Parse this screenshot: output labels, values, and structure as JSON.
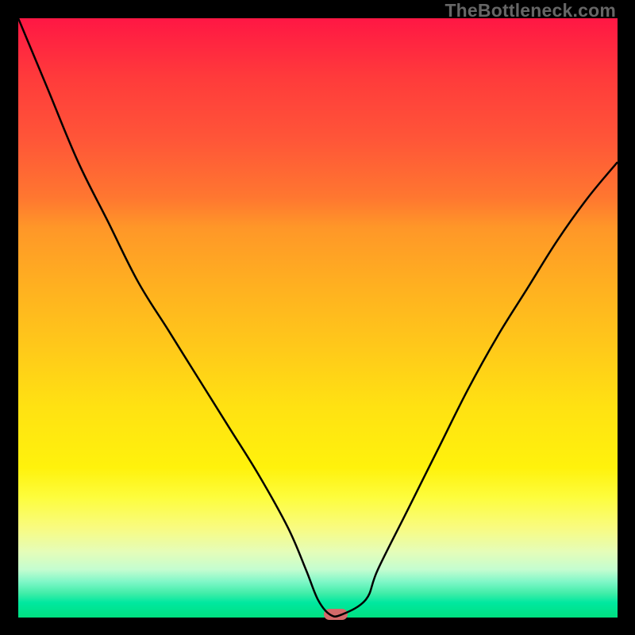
{
  "watermark": "TheBottleneck.com",
  "chart_data": {
    "type": "line",
    "x": [
      0,
      5,
      10,
      15,
      20,
      25,
      30,
      35,
      40,
      45,
      48,
      50,
      52,
      54,
      58,
      60,
      65,
      70,
      75,
      80,
      85,
      90,
      95,
      100
    ],
    "values": [
      100,
      88,
      76,
      66,
      56,
      48,
      40,
      32,
      24,
      15,
      8,
      3,
      0.5,
      0.5,
      3,
      8,
      18,
      28,
      38,
      47,
      55,
      63,
      70,
      76
    ],
    "xlim": [
      0,
      100
    ],
    "ylim": [
      0,
      100
    ],
    "marker": {
      "x": 53,
      "y": 0.5
    },
    "gradient_stops": [
      {
        "pos": 0,
        "color": "#ff1744"
      },
      {
        "pos": 50,
        "color": "#ffd015"
      },
      {
        "pos": 80,
        "color": "#fdfd3d"
      },
      {
        "pos": 100,
        "color": "#00e080"
      }
    ]
  }
}
